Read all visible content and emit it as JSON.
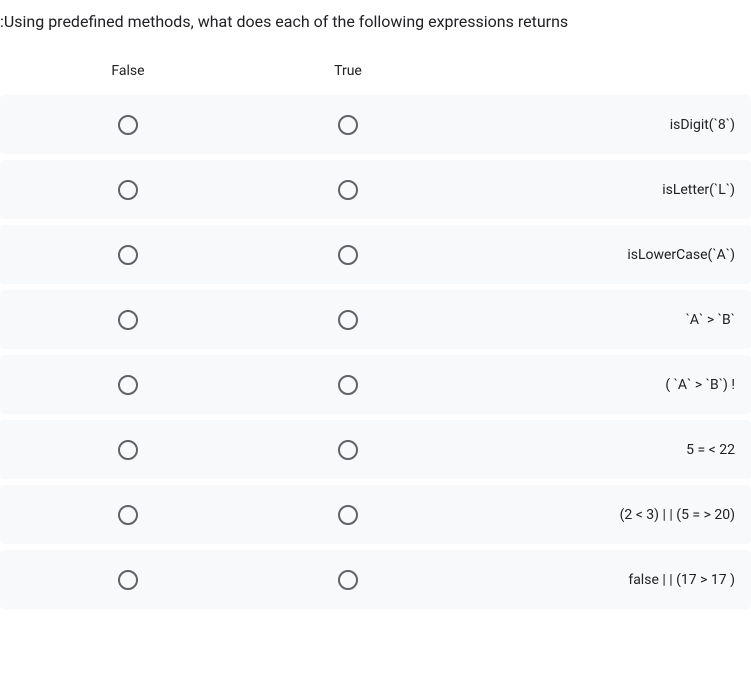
{
  "question": ":Using predefined methods, what does each of the following expressions returns",
  "headers": {
    "false": "False",
    "true": "True"
  },
  "rows": [
    {
      "expression": "isDigit(`8`)"
    },
    {
      "expression": "isLetter(`L`)"
    },
    {
      "expression": "isLowerCase(`A`)"
    },
    {
      "expression": "`A` > `B`"
    },
    {
      "expression": "( `A` > `B`) !"
    },
    {
      "expression": "5 = < 22"
    },
    {
      "expression": "(2 < 3) | | (5 = > 20)"
    },
    {
      "expression": "false | | (17 > 17 )"
    }
  ]
}
